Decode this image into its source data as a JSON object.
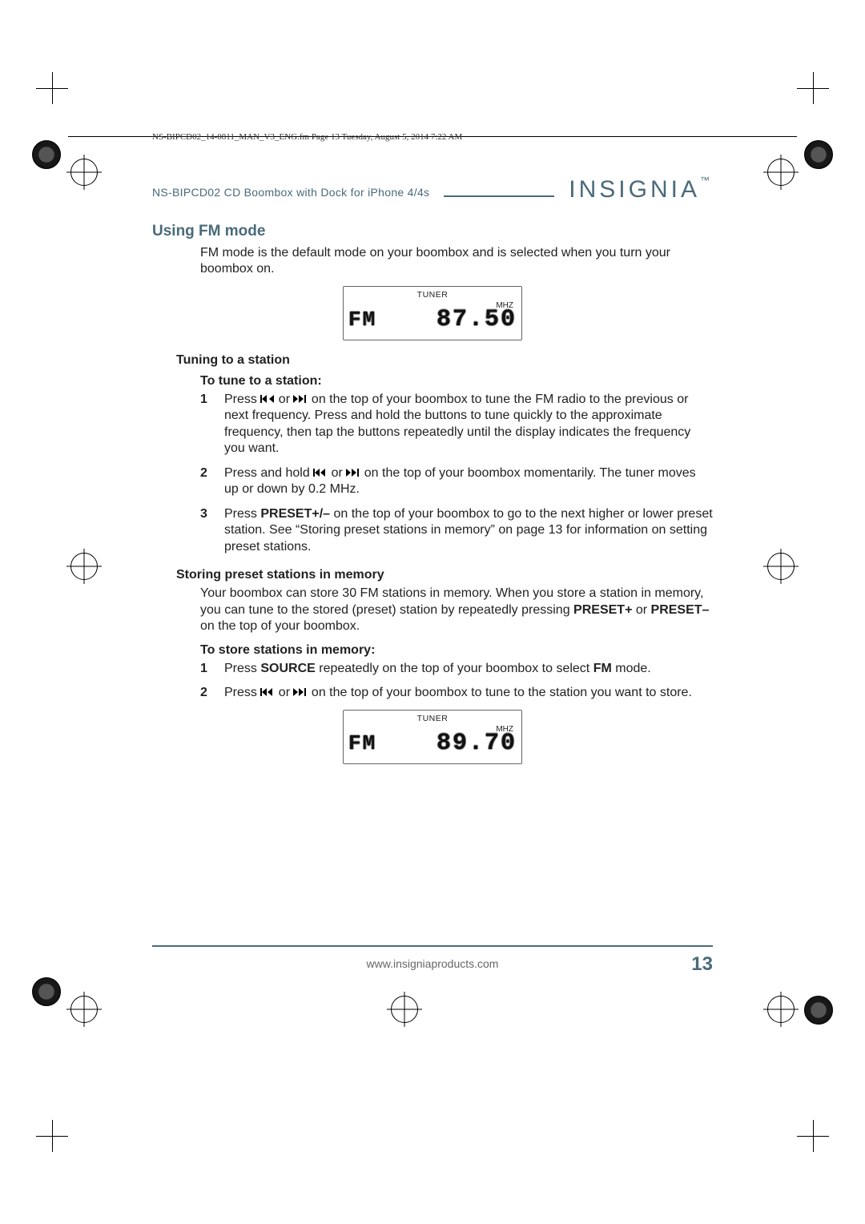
{
  "meta": {
    "frame_header": "NS-BIPCD02_14-0811_MAN_V3_ENG.fm  Page 13  Tuesday, August 5, 2014  7:22 AM"
  },
  "header": {
    "product_line": "NS-BIPCD02 CD Boombox with Dock for iPhone 4/4s",
    "brand": "INSIGNIA",
    "brand_tm": "™"
  },
  "section": {
    "title": "Using FM mode",
    "intro": "FM mode is the default mode on your boombox and is selected when you turn your boombox on."
  },
  "lcd1": {
    "top": "TUNER",
    "unit": "MHZ",
    "band": "FM",
    "freq": "87.50"
  },
  "tuning": {
    "heading": "Tuning to a station",
    "subhead": "To tune to a station:",
    "step1_pre": "Press ",
    "step1_mid": " or ",
    "step1_post": " on the top of your boombox to tune the FM radio to the previous or next frequency. Press and hold the buttons to tune quickly to the approximate frequency, then tap the buttons repeatedly until the display indicates the frequency you want.",
    "step2_pre": "Press and hold ",
    "step2_mid": " or ",
    "step2_post": " on the top of your boombox momentarily. The tuner moves up or down by 0.2 MHz.",
    "step3_pre": "Press ",
    "step3_bold": "PRESET+/–",
    "step3_post": " on the top of your boombox to go to the next higher or lower preset station. See “Storing preset stations in memory” on page 13 for information on setting preset stations."
  },
  "storing": {
    "heading": "Storing preset stations in memory",
    "intro_a": "Your boombox can store 30 FM stations in memory. When you store a station in memory, you can tune to the stored (preset) station by repeatedly pressing ",
    "intro_b1": "PRESET+",
    "intro_mid": " or ",
    "intro_b2": "PRESET–",
    "intro_post": " on the top of your boombox.",
    "subhead": "To store stations in memory:",
    "step1_pre": "Press ",
    "step1_bold": "SOURCE",
    "step1_mid": " repeatedly on the top of your boombox to select ",
    "step1_bold2": "FM",
    "step1_post": " mode.",
    "step2_pre": "Press ",
    "step2_mid": " or ",
    "step2_post": " on the top of your boombox to tune to the station you want to store."
  },
  "lcd2": {
    "top": "TUNER",
    "unit": "MHZ",
    "band": "FM",
    "freq": "89.70"
  },
  "footer": {
    "url": "www.insigniaproducts.com",
    "page": "13"
  }
}
